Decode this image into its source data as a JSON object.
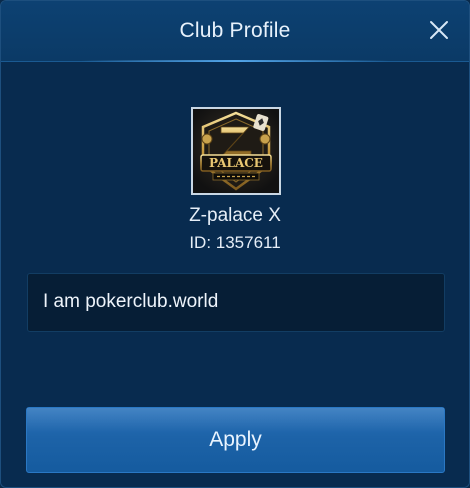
{
  "header": {
    "title": "Club Profile",
    "close_icon": "close-icon"
  },
  "club": {
    "logo_icon": "club-logo-image",
    "name": "Z-palace X",
    "id_text": "ID: 1357611",
    "description": "I am pokerclub.world"
  },
  "actions": {
    "apply_label": "Apply"
  },
  "colors": {
    "panel_background": "#082b4f",
    "header_background": "#0b3a66",
    "button_blue": "#1d63a8",
    "text": "#e6eef7"
  }
}
